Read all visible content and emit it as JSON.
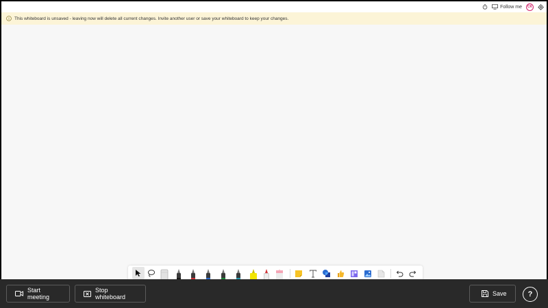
{
  "topbar": {
    "follow_label": "Follow me",
    "avatar_initials": "CK",
    "icons": [
      "timer-icon",
      "follow-me-icon",
      "settings-icon"
    ]
  },
  "banner": {
    "icon": "info-icon",
    "text": "This whiteboard is unsaved - leaving now will delete all current changes. Invite another user or save your whiteboard to keep your changes."
  },
  "toolbar": {
    "tools": [
      "select",
      "lasso",
      "eraser",
      "pen-black",
      "pen-red",
      "pen-blue",
      "pen-green",
      "pen-teal",
      "highlighter-yellow",
      "highlighter-white",
      "highlighter-pink",
      "sticky-note",
      "text",
      "shapes",
      "reactions",
      "templates",
      "image",
      "document",
      "undo",
      "redo"
    ],
    "pen_colors": [
      "#1a1a1a",
      "#d13438",
      "#2b6cd0",
      "#1e8a3a",
      "#2a9db5",
      "#f2e600",
      "#ffffff",
      "#f4a6b6"
    ]
  },
  "bottombar": {
    "start_meeting_label": "Start meeting",
    "stop_whiteboard_label": "Stop whiteboard",
    "save_label": "Save",
    "help_label": "?"
  },
  "colors": {
    "banner_bg": "#fcf4d7",
    "bottombar_bg": "#292929",
    "avatar_ring": "#d1246b",
    "canvas_bg": "#f7f7f7"
  }
}
